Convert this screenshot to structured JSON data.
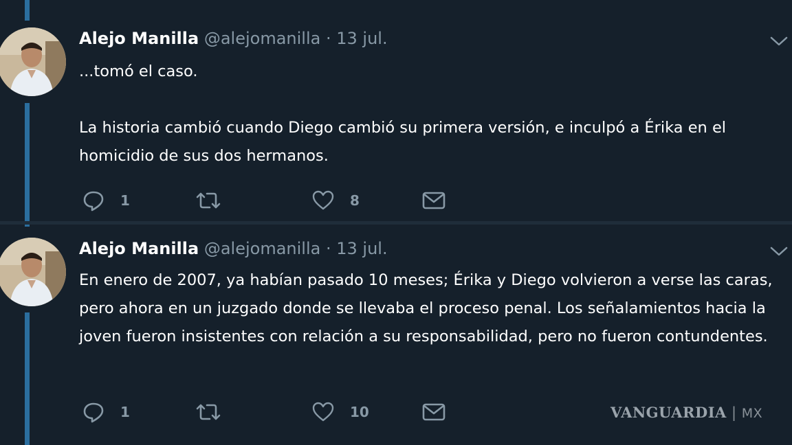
{
  "tweets": [
    {
      "author_name": "Alejo Manilla",
      "handle": "@alejomanilla",
      "separator": "·",
      "date": "13 jul.",
      "paragraphs": [
        "...tomó el caso.",
        "La historia cambió cuando Diego cambió su primera versión, e inculpó a Érika en el homicidio de sus dos hermanos."
      ],
      "reply_count": "1",
      "retweet_count": "",
      "like_count": "8"
    },
    {
      "author_name": "Alejo Manilla",
      "handle": "@alejomanilla",
      "separator": "·",
      "date": "13 jul.",
      "paragraphs": [
        "En enero de 2007, ya habían pasado 10 meses; Érika y Diego volvieron a verse las caras, pero ahora en un juzgado donde se llevaba el proceso penal. Los señalamientos hacia la joven fueron insistentes con relación a su responsabilidad, pero no fueron contundentes."
      ],
      "reply_count": "1",
      "retweet_count": "",
      "like_count": "10"
    }
  ],
  "watermark": {
    "brand": "VANGUARDIA",
    "suffix": "MX"
  },
  "icons": {
    "reply": "reply-icon",
    "retweet": "retweet-icon",
    "like": "heart-icon",
    "message": "mail-icon",
    "menu": "chevron-down-icon"
  },
  "colors": {
    "background": "#15202b",
    "text": "#ffffff",
    "secondary": "#8899a6",
    "thread_line": "#2b6e9e"
  }
}
